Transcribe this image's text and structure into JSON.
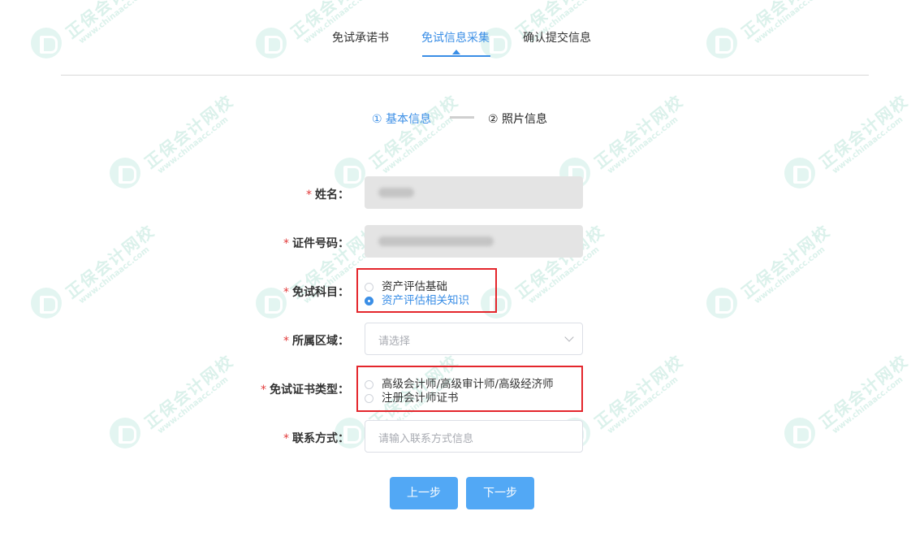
{
  "tabs": [
    {
      "label": "免试承诺书",
      "active": false
    },
    {
      "label": "免试信息采集",
      "active": true
    },
    {
      "label": "确认提交信息",
      "active": false
    }
  ],
  "steps": [
    {
      "label": "① 基本信息",
      "active": true
    },
    {
      "label": "② 照片信息",
      "active": false
    }
  ],
  "form": {
    "required_mark": "*",
    "name_label": "姓名：",
    "id_label": "证件号码：",
    "subject_label": "免试科目：",
    "subject_options": [
      {
        "label": "资产评估基础",
        "checked": false
      },
      {
        "label": "资产评估相关知识",
        "checked": true
      }
    ],
    "region_label": "所属区域：",
    "region_placeholder": "请选择",
    "cert_label": "免试证书类型：",
    "cert_options": [
      {
        "label": "高级会计师/高级审计师/高级经济师",
        "checked": false
      },
      {
        "label": "注册会计师证书",
        "checked": false
      }
    ],
    "contact_label": "联系方式：",
    "contact_placeholder": "请输入联系方式信息"
  },
  "buttons": {
    "prev": "上一步",
    "next": "下一步"
  },
  "watermark": {
    "brand": "正保会计网校",
    "url": "www.chinaacc.com"
  },
  "colors": {
    "accent": "#3a8ee6",
    "highlight_box": "#e4262c",
    "button": "#52a8f5"
  }
}
